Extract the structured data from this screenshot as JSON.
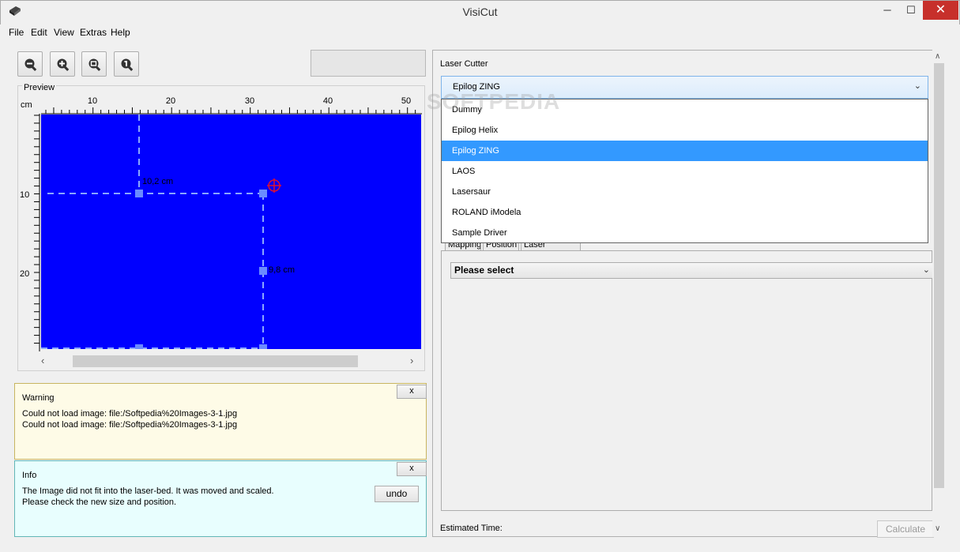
{
  "window": {
    "title": "VisiCut",
    "minimize_glyph": "─",
    "maximize_glyph": "☐",
    "close_glyph": "✕"
  },
  "menu": [
    "File",
    "Edit",
    "View",
    "Extras",
    "Help"
  ],
  "toolbar": {
    "icons": [
      "zoom-out-icon",
      "zoom-in-icon",
      "zoom-fit-icon",
      "zoom-actual-icon"
    ]
  },
  "preview": {
    "label": "Preview",
    "unit": "cm",
    "x_ticks": [
      "10",
      "20",
      "30",
      "40",
      "50"
    ],
    "y_ticks": [
      "10",
      "20"
    ],
    "width_label": "10,2 cm",
    "height_label": "9,8 cm",
    "canvas_color": "#0000ff",
    "scroll_left": "‹",
    "scroll_right": "›"
  },
  "warning": {
    "title": "Warning",
    "lines": [
      "Could not load image: file:/Softpedia%20Images-3-1.jpg",
      "Could not load image: file:/Softpedia%20Images-3-1.jpg"
    ],
    "close_label": "x"
  },
  "info": {
    "title": "Info",
    "lines": [
      "The Image did not fit into the laser-bed. It was moved and scaled.",
      "Please check the new size and position."
    ],
    "close_label": "x",
    "undo_label": "undo"
  },
  "laser_cutter": {
    "label": "Laser Cutter",
    "selected": "Epilog ZING",
    "chevron": "⌄",
    "options": [
      "Dummy",
      "Epilog Helix",
      "Epilog ZING",
      "LAOS",
      "Lasersaur",
      "ROLAND iModela",
      "Sample Driver"
    ],
    "selected_index": 2
  },
  "tabs": [
    "Mapping",
    "Position",
    "Laser Settings"
  ],
  "profile_select": {
    "value": "Please select",
    "chevron": "⌄"
  },
  "footer": {
    "estimated_label": "Estimated Time:",
    "calculate_label": "Calculate"
  },
  "scrollbar": {
    "up": "∧",
    "down": "∨"
  },
  "watermark": "SOFTPEDIA",
  "colors": {
    "selection": "#3399ff",
    "canvas": "#0000ff",
    "handle": "#6a8bff",
    "crosshair": "#e0102f"
  }
}
